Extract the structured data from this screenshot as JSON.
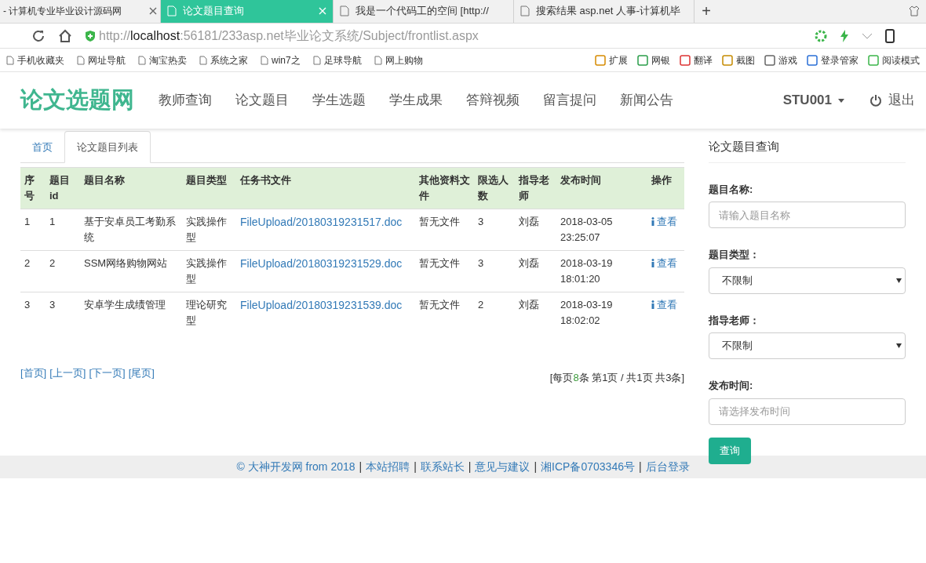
{
  "browser": {
    "tabs": [
      {
        "title": "- 计算机专业毕业设计源码网",
        "selected": false,
        "closable": true
      },
      {
        "title": "论文题目查询",
        "selected": true,
        "closable": true
      },
      {
        "title": "我是一个代码工的空间 [http://",
        "selected": false,
        "closable": false
      },
      {
        "title": "搜索结果 asp.net 人事-计算机毕",
        "selected": false,
        "closable": false
      }
    ],
    "new_tab": "+",
    "url": {
      "scheme": "http://",
      "host": "localhost",
      "path": ":56181/233asp.net毕业论文系统/Subject/frontlist.aspx"
    },
    "bookmarks": [
      "手机收藏夹",
      "网址导航",
      "淘宝热卖",
      "系统之家",
      "win7之",
      "足球导航",
      "网上购物"
    ],
    "tools": [
      "扩展",
      "网银",
      "翻译",
      "截图",
      "游戏",
      "登录管家",
      "阅读模式"
    ]
  },
  "site": {
    "logo": "论文选题网",
    "nav": [
      "教师查询",
      "论文题目",
      "学生选题",
      "学生成果",
      "答辩视频",
      "留言提问",
      "新闻公告"
    ],
    "user": "STU001",
    "logout": "退出"
  },
  "content_tabs": [
    {
      "label": "首页",
      "selected": false
    },
    {
      "label": "论文题目列表",
      "selected": true
    }
  ],
  "table": {
    "columns": [
      "序号",
      "题目id",
      "题目名称",
      "题目类型",
      "任务书文件",
      "其他资料文件",
      "限选人数",
      "指导老师",
      "发布时间",
      "操作"
    ],
    "rows": [
      {
        "no": "1",
        "id": "1",
        "name": "基于安卓员工考勤系统",
        "type": "实践操作型",
        "file": "FileUpload/20180319231517.doc",
        "other": "暂无文件",
        "limit": "3",
        "teacher": "刘磊",
        "time": "2018-03-05 23:25:07",
        "action": "查看"
      },
      {
        "no": "2",
        "id": "2",
        "name": "SSM网络购物网站",
        "type": "实践操作型",
        "file": "FileUpload/20180319231529.doc",
        "other": "暂无文件",
        "limit": "3",
        "teacher": "刘磊",
        "time": "2018-03-19 18:01:20",
        "action": "查看"
      },
      {
        "no": "3",
        "id": "3",
        "name": "安卓学生成绩管理",
        "type": "理论研究型",
        "file": "FileUpload/20180319231539.doc",
        "other": "暂无文件",
        "limit": "2",
        "teacher": "刘磊",
        "time": "2018-03-19 18:02:02",
        "action": "查看"
      }
    ]
  },
  "pager": {
    "links": [
      "[首页]",
      "[上一页]",
      "[下一页]",
      "[尾页]"
    ],
    "info": [
      {
        "text": "[每页",
        "highlight": false
      },
      {
        "text": "8",
        "highlight": true
      },
      {
        "text": "条 第",
        "highlight": false
      },
      {
        "text": "1",
        "highlight": false
      },
      {
        "text": "页 / 共1页 共3条]",
        "highlight": false
      }
    ]
  },
  "search": {
    "title": "论文题目查询",
    "fields": [
      {
        "kind": "text",
        "label": "题目名称:",
        "placeholder": "请输入题目名称"
      },
      {
        "kind": "select",
        "label": "题目类型：",
        "value": "不限制"
      },
      {
        "kind": "select",
        "label": "指导老师：",
        "value": "不限制"
      },
      {
        "kind": "text",
        "label": "发布时间:",
        "placeholder": "请选择发布时间"
      }
    ],
    "button": "查询"
  },
  "footer": {
    "links": [
      "© 大神开发网 from 2018",
      "本站招聘",
      "联系站长",
      "意见与建议",
      "湘ICP备0703346号",
      "后台登录"
    ],
    "separator": "|"
  }
}
